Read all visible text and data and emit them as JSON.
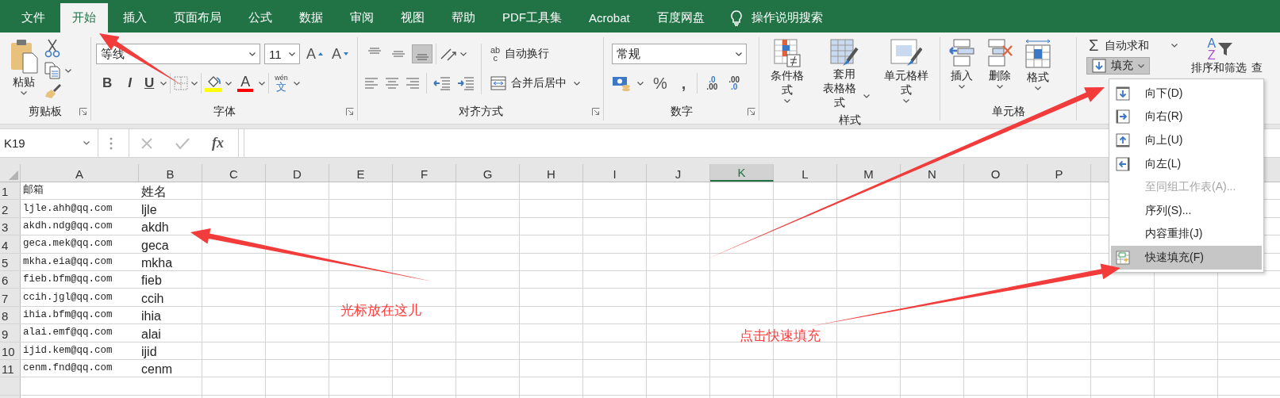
{
  "tabs": [
    {
      "label": "文件",
      "selected": false
    },
    {
      "label": "开始",
      "selected": true
    },
    {
      "label": "插入",
      "selected": false
    },
    {
      "label": "页面布局",
      "selected": false
    },
    {
      "label": "公式",
      "selected": false
    },
    {
      "label": "数据",
      "selected": false
    },
    {
      "label": "审阅",
      "selected": false
    },
    {
      "label": "视图",
      "selected": false
    },
    {
      "label": "帮助",
      "selected": false
    },
    {
      "label": "PDF工具集",
      "selected": false
    },
    {
      "label": "Acrobat",
      "selected": false
    },
    {
      "label": "百度网盘",
      "selected": false
    }
  ],
  "tell_me": {
    "placeholder": "操作说明搜索"
  },
  "ribbon": {
    "clipboard": {
      "paste": "粘贴",
      "label": "剪贴板"
    },
    "font": {
      "font_name": "等线",
      "font_size": "11",
      "grow": "A",
      "shrink": "A",
      "bold": "B",
      "italic": "I",
      "underline": "U",
      "font_color": "A",
      "phonetic": {
        "top": "wén",
        "bottom": "文"
      },
      "label": "字体"
    },
    "alignment": {
      "vertical_align": [
        {
          "kind": "top",
          "selected": false
        },
        {
          "kind": "middle",
          "selected": false
        },
        {
          "kind": "bottom",
          "selected": true
        }
      ],
      "wrap_glyph": {
        "top": "ab",
        "bottom": "c"
      },
      "wrap_text": "自动换行",
      "merge_center": "合并后居中",
      "label": "对齐方式"
    },
    "number": {
      "format": "常规",
      "percent": "%",
      "comma": ",",
      "increase_decimal": {
        "top": ".0",
        "bottom": ".00"
      },
      "decrease_decimal": {
        "top": ".00",
        "bottom": ".0"
      },
      "label": "数字"
    },
    "styles": {
      "conditional": "条件格式",
      "table_format": [
        "套用",
        "表格格式"
      ],
      "cell_styles": "单元格样式",
      "label": "样式"
    },
    "cells": {
      "insert": "插入",
      "delete": "删除",
      "format": "格式",
      "label": "单元格"
    },
    "editing": {
      "autosum_glyph": "Σ",
      "autosum": "自动求和",
      "fill": {
        "label": "填充",
        "open": true
      },
      "sort_glyph": {
        "top": "A",
        "bottom": "Z"
      },
      "sort_filter": "排序和筛选",
      "find": "查"
    }
  },
  "formula_bar": {
    "name_box": "K19",
    "fx": "fx"
  },
  "sheet": {
    "columns": [
      {
        "label": "A",
        "selected": false
      },
      {
        "label": "B",
        "selected": false
      },
      {
        "label": "C",
        "selected": false
      },
      {
        "label": "D",
        "selected": false
      },
      {
        "label": "E",
        "selected": false
      },
      {
        "label": "F",
        "selected": false
      },
      {
        "label": "G",
        "selected": false
      },
      {
        "label": "H",
        "selected": false
      },
      {
        "label": "I",
        "selected": false
      },
      {
        "label": "J",
        "selected": false
      },
      {
        "label": "K",
        "selected": true
      },
      {
        "label": "L",
        "selected": false
      },
      {
        "label": "M",
        "selected": false
      },
      {
        "label": "N",
        "selected": false
      },
      {
        "label": "O",
        "selected": false
      },
      {
        "label": "P",
        "selected": false
      }
    ],
    "rows": [
      {
        "number": "1",
        "cells": [
          "邮箱",
          "姓名"
        ]
      },
      {
        "number": "2",
        "cells": [
          "ljle.ahh@qq.com",
          "ljle"
        ]
      },
      {
        "number": "3",
        "cells": [
          "akdh.ndg@qq.com",
          "akdh"
        ]
      },
      {
        "number": "4",
        "cells": [
          "geca.mek@qq.com",
          "geca"
        ]
      },
      {
        "number": "5",
        "cells": [
          "mkha.eia@qq.com",
          "mkha"
        ]
      },
      {
        "number": "6",
        "cells": [
          "fieb.bfm@qq.com",
          "fieb"
        ]
      },
      {
        "number": "7",
        "cells": [
          "ccih.jgl@qq.com",
          "ccih"
        ]
      },
      {
        "number": "8",
        "cells": [
          "ihia.bfm@qq.com",
          "ihia"
        ]
      },
      {
        "number": "9",
        "cells": [
          "alai.emf@qq.com",
          "alai"
        ]
      },
      {
        "number": "10",
        "cells": [
          "ijid.kem@qq.com",
          "ijid"
        ]
      },
      {
        "number": "11",
        "cells": [
          "cenm.fnd@qq.com",
          "cenm"
        ]
      }
    ]
  },
  "fill_menu": {
    "items": [
      {
        "label": "向下(D)",
        "kind": "down",
        "disabled": false,
        "selected": false
      },
      {
        "label": "向右(R)",
        "kind": "right",
        "disabled": false,
        "selected": false
      },
      {
        "label": "向上(U)",
        "kind": "up",
        "disabled": false,
        "selected": false
      },
      {
        "label": "向左(L)",
        "kind": "left",
        "disabled": false,
        "selected": false
      },
      {
        "label": "至同组工作表(A)...",
        "kind": "sheets",
        "disabled": true,
        "selected": false
      },
      {
        "label": "序列(S)...",
        "kind": "series",
        "disabled": false,
        "selected": false
      },
      {
        "label": "内容重排(J)",
        "kind": "justify",
        "disabled": false,
        "selected": false
      },
      {
        "label": "快速填充(F)",
        "kind": "flash",
        "disabled": false,
        "selected": true
      }
    ]
  },
  "annotations": [
    {
      "text": "光标放在这儿"
    },
    {
      "text": "点击快速填充"
    }
  ]
}
